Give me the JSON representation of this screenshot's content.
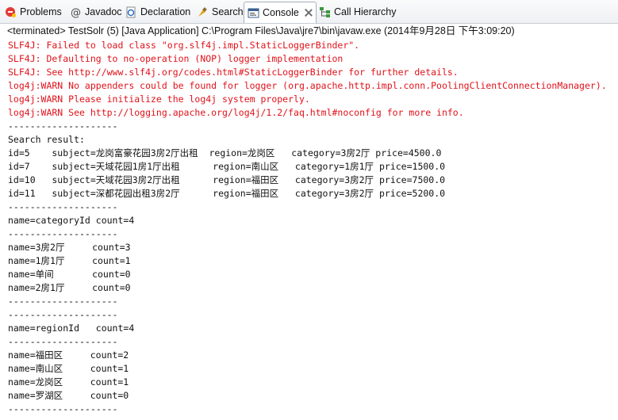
{
  "tabs": [
    {
      "label": "Problems",
      "icon": "problems-icon",
      "active": false
    },
    {
      "label": "Javadoc",
      "icon": "javadoc-icon",
      "active": false
    },
    {
      "label": "Declaration",
      "icon": "declaration-icon",
      "active": false
    },
    {
      "label": "Search",
      "icon": "search-icon",
      "active": false
    },
    {
      "label": "Console",
      "icon": "console-icon",
      "active": true
    },
    {
      "label": "Call Hierarchy",
      "icon": "call-hierarchy-icon",
      "active": false
    }
  ],
  "status": "<terminated> TestSolr (5) [Java Application] C:\\Program Files\\Java\\jre7\\bin\\javaw.exe (2014年9月28日 下午3:09:20)",
  "console": {
    "lines": [
      {
        "text": "SLF4J: Failed to load class \"org.slf4j.impl.StaticLoggerBinder\".",
        "err": true
      },
      {
        "text": "SLF4J: Defaulting to no-operation (NOP) logger implementation",
        "err": true
      },
      {
        "text": "SLF4J: See http://www.slf4j.org/codes.html#StaticLoggerBinder for further details.",
        "err": true
      },
      {
        "text": "log4j:WARN No appenders could be found for logger (org.apache.http.impl.conn.PoolingClientConnectionManager).",
        "err": true
      },
      {
        "text": "log4j:WARN Please initialize the log4j system properly.",
        "err": true
      },
      {
        "text": "log4j:WARN See http://logging.apache.org/log4j/1.2/faq.html#noconfig for more info.",
        "err": true
      },
      {
        "text": "--------------------",
        "err": false
      },
      {
        "text": "Search result:",
        "err": false
      },
      {
        "text": "id=5    subject=龙岗富豪花园3房2厅出租  region=龙岗区   category=3房2厅 price=4500.0",
        "err": false
      },
      {
        "text": "id=7    subject=天域花园1房1厅出租      region=南山区   category=1房1厅 price=1500.0",
        "err": false
      },
      {
        "text": "id=10   subject=天域花园3房2厅出租      region=福田区   category=3房2厅 price=7500.0",
        "err": false
      },
      {
        "text": "id=11   subject=深都花园出租3房2厅      region=福田区   category=3房2厅 price=5200.0",
        "err": false
      },
      {
        "text": "--------------------",
        "err": false
      },
      {
        "text": "name=categoryId count=4",
        "err": false
      },
      {
        "text": "--------------------",
        "err": false
      },
      {
        "text": "name=3房2厅     count=3",
        "err": false
      },
      {
        "text": "name=1房1厅     count=1",
        "err": false
      },
      {
        "text": "name=单间       count=0",
        "err": false
      },
      {
        "text": "name=2房1厅     count=0",
        "err": false
      },
      {
        "text": "--------------------",
        "err": false
      },
      {
        "text": "--------------------",
        "err": false
      },
      {
        "text": "name=regionId   count=4",
        "err": false
      },
      {
        "text": "--------------------",
        "err": false
      },
      {
        "text": "name=福田区     count=2",
        "err": false
      },
      {
        "text": "name=南山区     count=1",
        "err": false
      },
      {
        "text": "name=龙岗区     count=1",
        "err": false
      },
      {
        "text": "name=罗湖区     count=0",
        "err": false
      },
      {
        "text": "--------------------",
        "err": false
      }
    ]
  },
  "colors": {
    "error_text": "#e0121a",
    "normal_text": "#111111",
    "tab_active_border": "#a7b0bf"
  }
}
